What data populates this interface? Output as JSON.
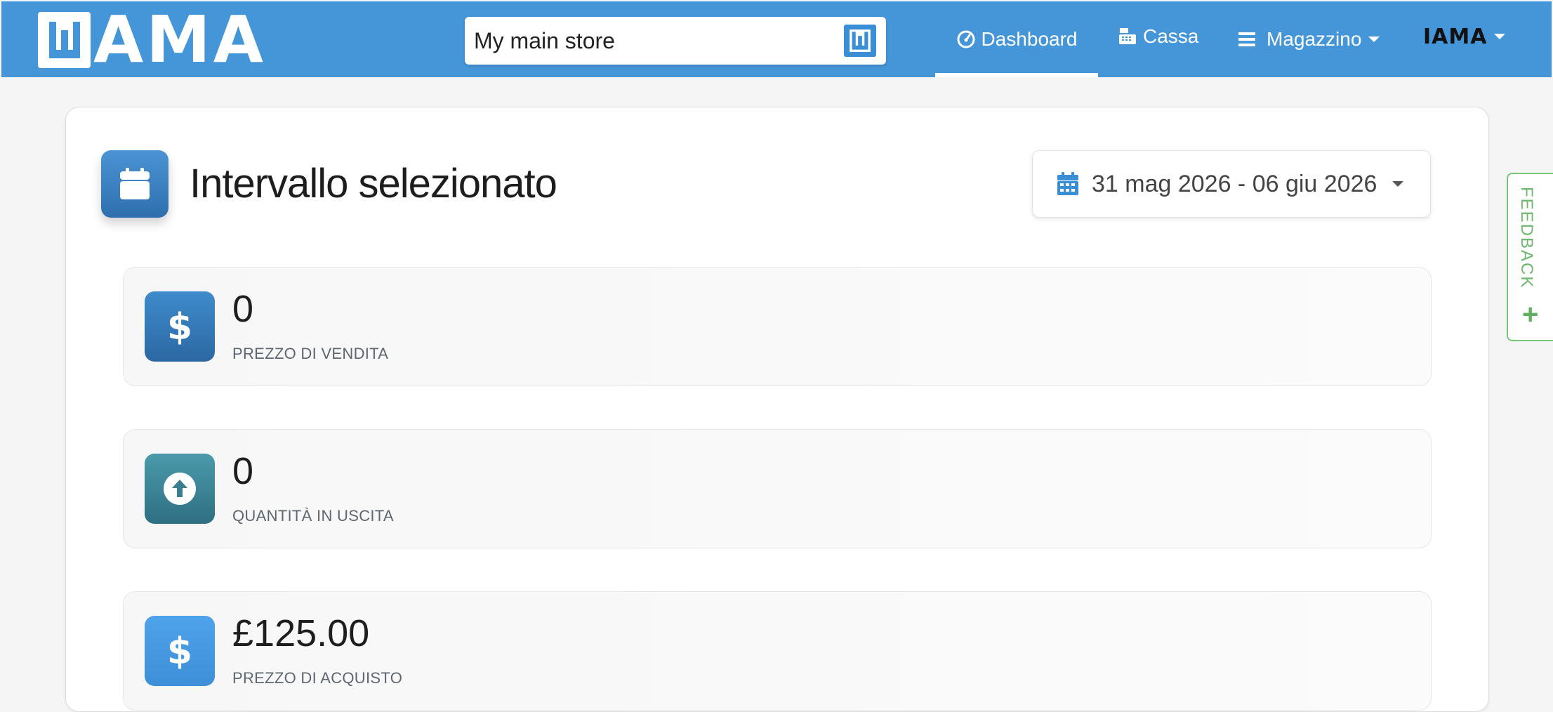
{
  "navbar": {
    "logo_text": "AMA",
    "store": "My main store",
    "items": [
      {
        "label": "Dashboard",
        "icon": "gauge-icon"
      },
      {
        "label": "Cassa",
        "icon": "cash-register-icon"
      },
      {
        "label": "Magazzino",
        "icon": "bars-icon"
      }
    ],
    "user_label": "IAMA",
    "accent": "#4596d9"
  },
  "main": {
    "title": "Intervallo selezionato",
    "date_range": "31 mag 2026 - 06 giu 2026",
    "stats": [
      {
        "value": "0",
        "label": "PREZZO DI VENDITA",
        "icon": "dollar-icon"
      },
      {
        "value": "0",
        "label": "QUANTITÀ IN USCITA",
        "icon": "arrow-up-circle-icon"
      },
      {
        "value": "£125.00",
        "label": "PREZZO DI ACQUISTO",
        "icon": "dollar-icon"
      }
    ]
  },
  "feedback": {
    "label": "FEEDBACK",
    "plus": "+"
  }
}
